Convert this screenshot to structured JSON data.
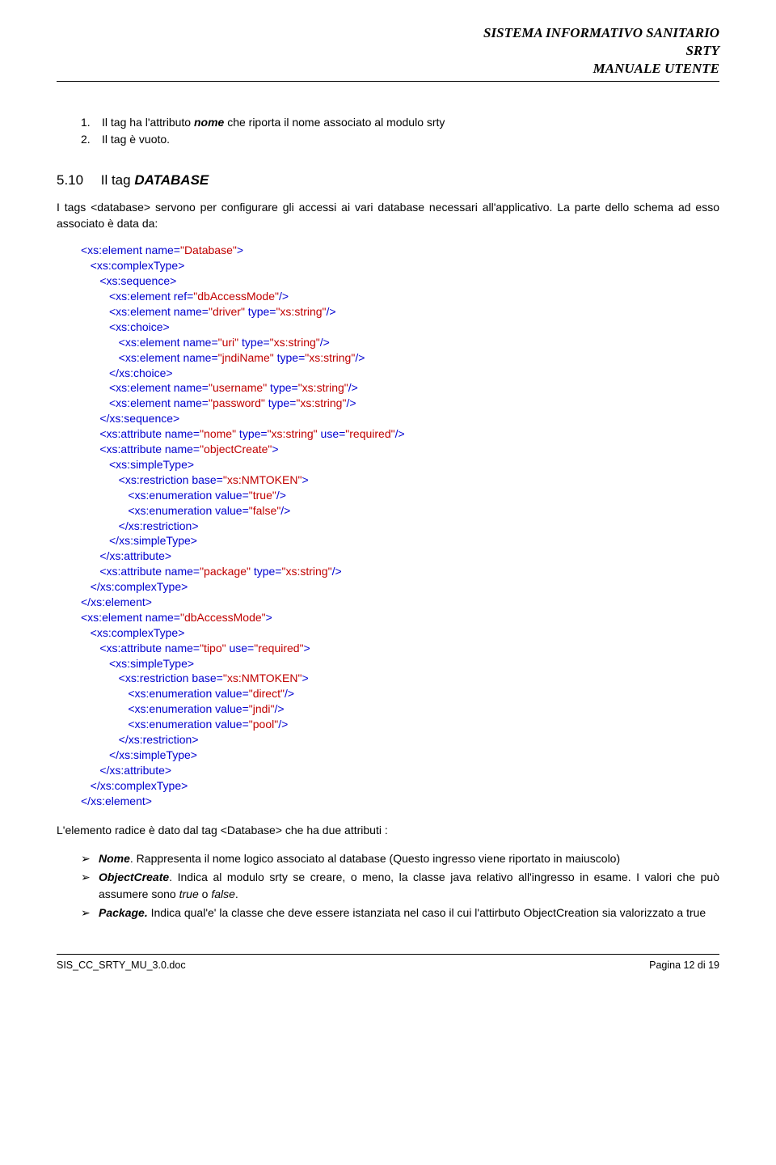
{
  "header": {
    "line1": "SISTEMA INFORMATIVO SANITARIO",
    "line2": "SRTY",
    "line3": "MANUALE UTENTE"
  },
  "numlist": {
    "n1": "1.",
    "t1a": "Il tag ha l'attributo ",
    "t1b": "nome",
    "t1c": "  che riporta il nome associato al modulo srty",
    "n2": "2.",
    "t2": "Il tag è vuoto."
  },
  "section": {
    "num": "5.10",
    "title_pre": "Il tag ",
    "title_em": "DATABASE"
  },
  "intro": "I tags <database> servono per configurare gli accessi ai vari database necessari all'applicativo. La parte dello schema ad esso associato è data da:",
  "code": {
    "l01a": "<xs:element name=",
    "l01b": "\"Database\"",
    "l01c": ">",
    "l02": "   <xs:complexType>",
    "l03": "      <xs:sequence>",
    "l04a": "         <xs:element ref=",
    "l04b": "\"dbAccessMode\"",
    "l04c": "/>",
    "l05a": "         <xs:element name=",
    "l05b": "\"driver\"",
    "l05c": " type=",
    "l05d": "\"xs:string\"",
    "l05e": "/>",
    "l06": "         <xs:choice>",
    "l07a": "            <xs:element name=",
    "l07b": "\"uri\"",
    "l07c": " type=",
    "l07d": "\"xs:string\"",
    "l07e": "/>",
    "l08a": "            <xs:element name=",
    "l08b": "\"jndiName\"",
    "l08c": " type=",
    "l08d": "\"xs:string\"",
    "l08e": "/>",
    "l09": "         </xs:choice>",
    "l10a": "         <xs:element name=",
    "l10b": "\"username\"",
    "l10c": " type=",
    "l10d": "\"xs:string\"",
    "l10e": "/>",
    "l11a": "         <xs:element name=",
    "l11b": "\"password\"",
    "l11c": " type=",
    "l11d": "\"xs:string\"",
    "l11e": "/>",
    "l12": "      </xs:sequence>",
    "l13a": "      <xs:attribute name=",
    "l13b": "\"nome\"",
    "l13c": " type=",
    "l13d": "\"xs:string\"",
    "l13e": " use=",
    "l13f": "\"required\"",
    "l13g": "/>",
    "l14a": "      <xs:attribute name=",
    "l14b": "\"objectCreate\"",
    "l14c": ">",
    "l15": "         <xs:simpleType>",
    "l16a": "            <xs:restriction base=",
    "l16b": "\"xs:NMTOKEN\"",
    "l16c": ">",
    "l17a": "               <xs:enumeration value=",
    "l17b": "\"true\"",
    "l17c": "/>",
    "l18a": "               <xs:enumeration value=",
    "l18b": "\"false\"",
    "l18c": "/>",
    "l19": "            </xs:restriction>",
    "l20": "         </xs:simpleType>",
    "l21": "      </xs:attribute>",
    "l22a": "      <xs:attribute name=",
    "l22b": "\"package\"",
    "l22c": " type=",
    "l22d": "\"xs:string\"",
    "l22e": "/>",
    "l23": "   </xs:complexType>",
    "l24": "</xs:element>",
    "l25a": "<xs:element name=",
    "l25b": "\"dbAccessMode\"",
    "l25c": ">",
    "l26": "   <xs:complexType>",
    "l27a": "      <xs:attribute name=",
    "l27b": "\"tipo\"",
    "l27c": " use=",
    "l27d": "\"required\"",
    "l27e": ">",
    "l28": "         <xs:simpleType>",
    "l29a": "            <xs:restriction base=",
    "l29b": "\"xs:NMTOKEN\"",
    "l29c": ">",
    "l30a": "               <xs:enumeration value=",
    "l30b": "\"direct\"",
    "l30c": "/>",
    "l31a": "               <xs:enumeration value=",
    "l31b": "\"jndi\"",
    "l31c": "/>",
    "l32a": "               <xs:enumeration value=",
    "l32b": "\"pool\"",
    "l32c": "/>",
    "l33": "            </xs:restriction>",
    "l34": "         </xs:simpleType>",
    "l35": "      </xs:attribute>",
    "l36": "   </xs:complexType>",
    "l37": "</xs:element>"
  },
  "outro": "L'elemento radice è dato dal tag <Database> che ha due attributi :",
  "bullets": {
    "arrow": "➢",
    "b1a": "Nome",
    "b1b": ". Rappresenta il nome logico associato al database (Questo ingresso viene riportato in maiuscolo)",
    "b2a": "ObjectCreate",
    "b2b": ". Indica al modulo srty se creare, o meno, la classe java relativo all'ingresso in esame. I valori che può assumere sono ",
    "b2c": "true",
    "b2d": " o ",
    "b2e": "false",
    "b2f": ".",
    "b3a": "Package.",
    "b3b": " Indica qual'e' la classe che deve essere istanziata nel caso il cui l'attirbuto ObjectCreation sia valorizzato a true"
  },
  "footer": {
    "left": "SIS_CC_SRTY_MU_3.0.doc",
    "right": "Pagina 12 di 19"
  }
}
